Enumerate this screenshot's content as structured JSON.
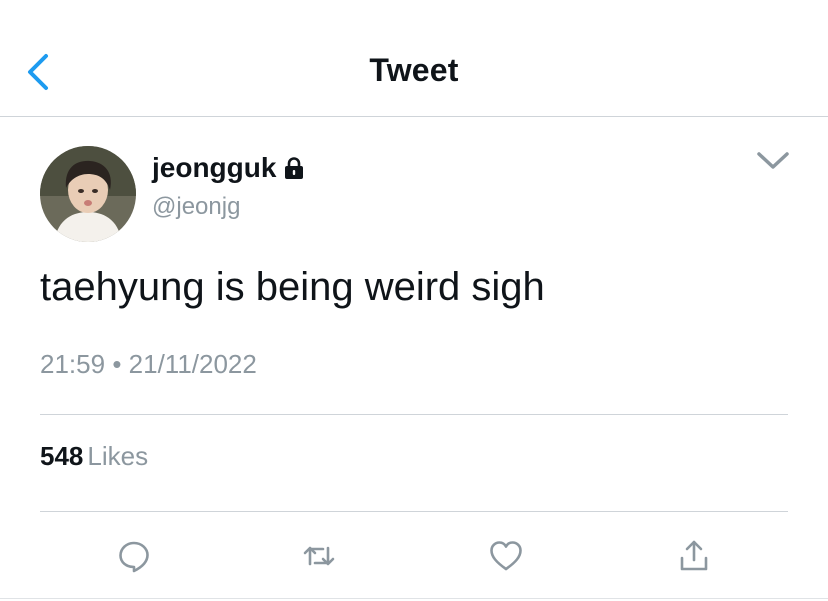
{
  "header": {
    "title": "Tweet",
    "back_icon": "chevron-left-icon"
  },
  "colors": {
    "accent": "#1d9bf0",
    "text": "#0f1419",
    "muted": "#8c979f",
    "divider": "#cfd4d9"
  },
  "user": {
    "name": "jeongguk",
    "handle": "@jeonjg",
    "lock_icon": "lock-icon"
  },
  "tweet": {
    "text": "taehyung is being weird sigh",
    "time": "21:59",
    "separator": "•",
    "date": "21/11/2022"
  },
  "stats": {
    "likes_count": "548",
    "likes_label": "Likes"
  },
  "actions": [
    "reply-icon",
    "retweet-icon",
    "like-icon",
    "share-icon"
  ]
}
